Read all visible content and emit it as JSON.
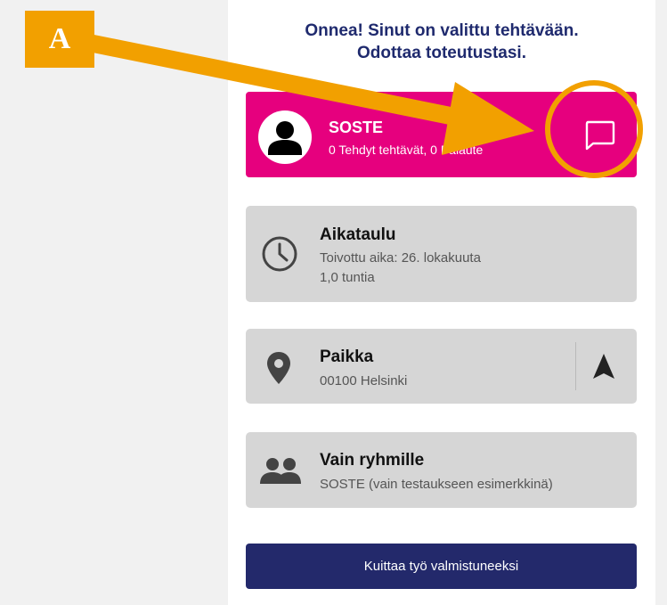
{
  "header": {
    "line1": "Onnea! Sinut on valittu tehtävään.",
    "line2": "Odottaa toteutustasi."
  },
  "requester": {
    "name": "SOSTE",
    "stats": "0 Tehdyt tehtävät, 0 Palaute",
    "icon": "person-icon",
    "chat_icon": "chat-icon",
    "bg_color": "#e6007e"
  },
  "schedule": {
    "title": "Aikataulu",
    "line1": "Toivottu aika: 26. lokakuuta",
    "line2": "1,0 tuntia",
    "icon": "clock-icon"
  },
  "place": {
    "title": "Paikka",
    "address": "00100 Helsinki",
    "icon": "location-pin-icon",
    "nav_icon": "navigation-arrow-icon"
  },
  "groups": {
    "title": "Vain ryhmille",
    "detail": "SOSTE (vain testaukseen esimerkkinä)",
    "icon": "group-icon"
  },
  "actions": {
    "complete_label": "Kuittaa työ valmistuneeksi"
  },
  "annotation": {
    "label": "A",
    "color": "#f2a000"
  },
  "colors": {
    "primary": "#23296b",
    "heading": "#1f2a6e",
    "card": "#d6d6d6"
  }
}
